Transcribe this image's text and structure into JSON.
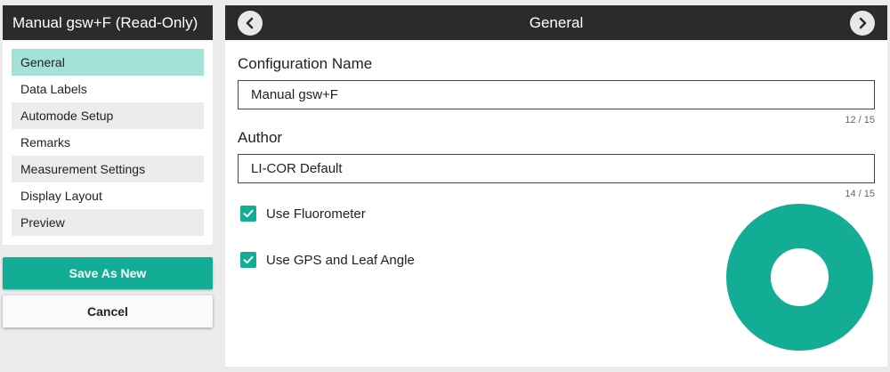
{
  "sidebar": {
    "title": "Manual gsw+F (Read-Only)",
    "items": [
      {
        "label": "General"
      },
      {
        "label": "Data Labels"
      },
      {
        "label": "Automode Setup"
      },
      {
        "label": "Remarks"
      },
      {
        "label": "Measurement Settings"
      },
      {
        "label": "Display Layout"
      },
      {
        "label": "Preview"
      }
    ],
    "active_index": 0,
    "save_label": "Save As New",
    "cancel_label": "Cancel"
  },
  "main": {
    "title": "General",
    "config_name": {
      "label": "Configuration Name",
      "value": "Manual gsw+F",
      "counter": "12 / 15"
    },
    "author": {
      "label": "Author",
      "value": "LI-COR Default",
      "counter": "14 / 15"
    },
    "checkboxes": [
      {
        "label": "Use Fluorometer",
        "checked": true
      },
      {
        "label": "Use GPS and Leaf Angle",
        "checked": true
      }
    ]
  },
  "colors": {
    "accent": "#13ad95",
    "active_item": "#a3e2d8",
    "header_bg": "#2b2b2b"
  },
  "icons": {
    "prev": "chevron-left-icon",
    "next": "chevron-right-icon",
    "check": "checkmark-icon",
    "loading": "loading-ring-icon"
  }
}
